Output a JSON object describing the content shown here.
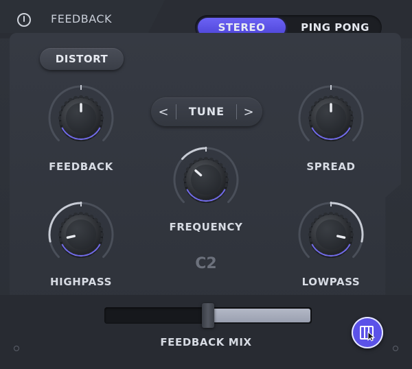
{
  "header": {
    "title": "FEEDBACK",
    "power_icon": "power-icon"
  },
  "mode": {
    "options": [
      "STEREO",
      "PING PONG"
    ],
    "selected": "STEREO"
  },
  "controls": {
    "distort_label": "DISTORT",
    "tune": {
      "label": "TUNE",
      "prev": "<",
      "next": ">"
    }
  },
  "knobs": {
    "feedback": {
      "label": "FEEDBACK",
      "value": 0.5
    },
    "spread": {
      "label": "SPREAD",
      "value": 0.5
    },
    "frequency": {
      "label": "FREQUENCY",
      "value": 0.32
    },
    "highpass": {
      "label": "HIGHPASS",
      "value": 0.12
    },
    "lowpass": {
      "label": "LOWPASS",
      "value": 0.88
    }
  },
  "frequency_note": "C2",
  "mix": {
    "label": "FEEDBACK MIX",
    "value": 0.5
  },
  "colors": {
    "accent": "#5b52e8",
    "accent_light": "#7a72ff"
  },
  "corner_icon": "piano-roll-icon"
}
